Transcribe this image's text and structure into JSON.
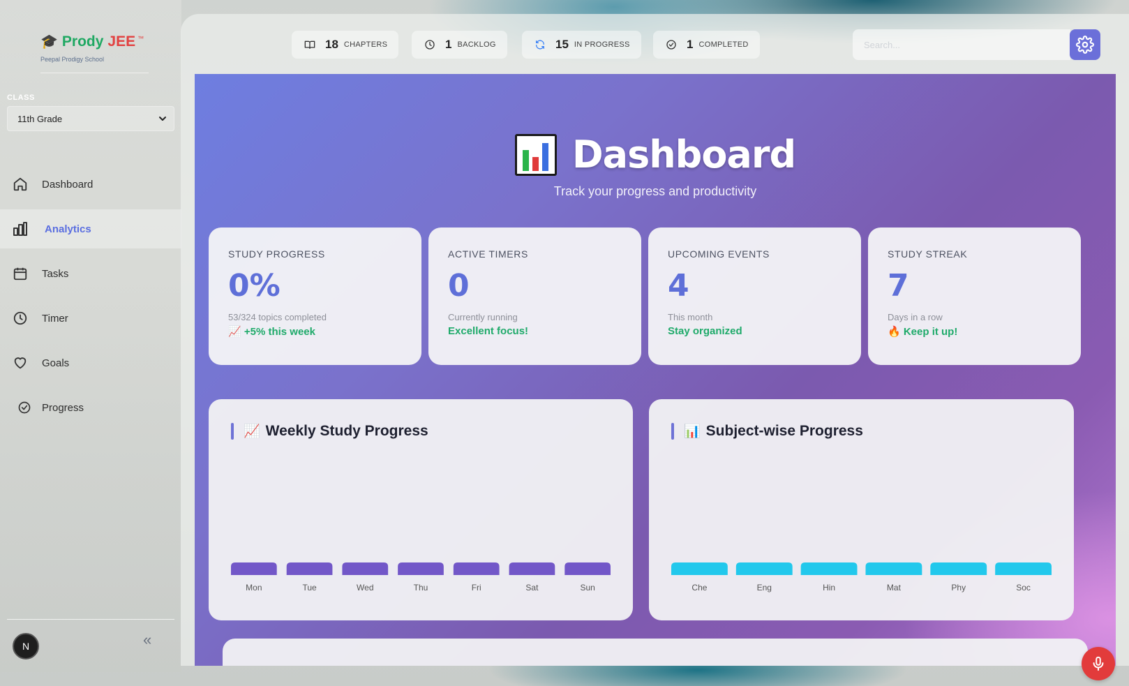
{
  "brand": {
    "name_part1": "Prody",
    "name_part2": "JEE",
    "trademark": "™",
    "school": "Peepal Prodigy School",
    "cap_icon": "graduation-cap-icon"
  },
  "sidebar": {
    "class_label": "CLASS",
    "class_value": "11th Grade",
    "items": [
      {
        "label": "Dashboard",
        "icon": "home-icon",
        "active": false
      },
      {
        "label": "Analytics",
        "icon": "bar-chart-icon",
        "active": true
      },
      {
        "label": "Tasks",
        "icon": "calendar-icon",
        "active": false
      },
      {
        "label": "Timer",
        "icon": "clock-icon",
        "active": false
      },
      {
        "label": "Goals",
        "icon": "heart-icon",
        "active": false
      },
      {
        "label": "Progress",
        "icon": "check-circle-icon",
        "active": false
      }
    ],
    "avatar_initial": "N",
    "collapse_icon": "«"
  },
  "topbar": {
    "stats": [
      {
        "value": "18",
        "label": "CHAPTERS",
        "icon": "book-icon"
      },
      {
        "value": "1",
        "label": "BACKLOG",
        "icon": "clock-icon"
      },
      {
        "value": "15",
        "label": "IN PROGRESS",
        "icon": "refresh-icon"
      },
      {
        "value": "1",
        "label": "COMPLETED",
        "icon": "check-circle-icon"
      }
    ],
    "search_placeholder": "Search...",
    "settings_icon": "gear-icon"
  },
  "hero": {
    "title": "Dashboard",
    "subtitle": "Track your progress and productivity",
    "icon": "bar-chart-emoji-icon"
  },
  "cards": [
    {
      "label": "STUDY PROGRESS",
      "value": "0%",
      "note": "53/324 topics completed",
      "trend": "📈 +5% this week"
    },
    {
      "label": "ACTIVE TIMERS",
      "value": "0",
      "note": "Currently running",
      "trend": "Excellent focus!"
    },
    {
      "label": "UPCOMING EVENTS",
      "value": "4",
      "note": "This month",
      "trend": "Stay organized"
    },
    {
      "label": "STUDY STREAK",
      "value": "7",
      "note": "Days in a row",
      "trend": "🔥 Keep it up!"
    }
  ],
  "charts": {
    "weekly": {
      "title": "Weekly Study Progress",
      "emoji": "📈"
    },
    "subject": {
      "title": "Subject-wise Progress",
      "emoji": "📊"
    }
  },
  "chart_data": [
    {
      "type": "bar",
      "title": "Weekly Study Progress",
      "categories": [
        "Mon",
        "Tue",
        "Wed",
        "Thu",
        "Fri",
        "Sat",
        "Sun"
      ],
      "values": [
        0,
        0,
        0,
        0,
        0,
        0,
        0
      ],
      "color": "#7257c8"
    },
    {
      "type": "bar",
      "title": "Subject-wise Progress",
      "categories": [
        "Che",
        "Eng",
        "Hin",
        "Mat",
        "Phy",
        "Soc"
      ],
      "values": [
        0,
        0,
        0,
        0,
        0,
        0
      ],
      "color": "#22c8ec"
    }
  ],
  "mic_icon": "microphone-icon"
}
